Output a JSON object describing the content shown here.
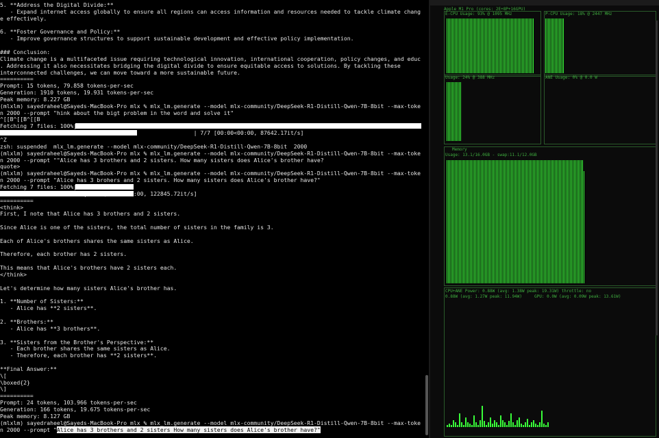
{
  "terminal": {
    "lines": [
      "5. **Address the Digital Divide:**",
      "   - Expand internet access globally to ensure all regions can access information and resources needed to tackle climate chang",
      "e effectively.",
      "",
      "6. **Foster Governance and Policy:**",
      "   - Improve governance structures to support sustainable development and effective policy implementation.",
      "",
      "### Conclusion:",
      "Climate change is a multifaceted issue requiring technological innovation, international cooperation, policy changes, and educ",
      ". Addressing it also necessitates bridging the digital divide to ensure equitable access to solutions. By tackling these",
      "interconnected challenges, we can move toward a more sustainable future.",
      "==========",
      "Prompt: 15 tokens, 79.858 tokens-per-sec",
      "Generation: 1910 tokens, 19.931 tokens-per-sec",
      "Peak memory: 8.227 GB",
      "(mlxlm) sayedraheel@Sayeds-MacBook-Pro mlx % mlx_lm.generate --model mlx-community/DeepSeek-R1-Distill-Qwen-7B-8bit --max-toke",
      "n 2000 --prompt \"hink about the bigt problem in the word and solve it\"",
      "^[[B^[[B^[[B",
      "Fetching 7 files: 100%|",
      "                                                          | 7/7 [00:00<00:00, 87642.17it/s]",
      "^Z",
      "zsh: suspended  mlx_lm.generate --model mlx-community/DeepSeek-R1-Distill-Qwen-7B-8bit  2000",
      "(mlxlm) sayedraheel@Sayeds-MacBook-Pro mlx % mlx_lm.generate --model mlx-community/DeepSeek-R1-Distill-Qwen-7B-8bit --max-toke",
      "n 2000 --prompt \"\"Alice has 3 brothers and 2 sisters. How many sisters does Alice's brother have?",
      "quote>",
      "(mlxlm) sayedraheel@Sayeds-MacBook-Pro mlx % mlx_lm.generate --model mlx-community/DeepSeek-R1-Distill-Qwen-7B-8bit --max-toke",
      "n 2000 --prompt \"Alice has 3 brohers and 2 sisters. How many sisters does Alice's brother have?\"",
      "Fetching 7 files: 100%|",
      "                         | 7/7 [00:00<00:00, 122845.72it/s]",
      "==========",
      "<think>",
      "First, I note that Alice has 3 brothers and 2 sisters.",
      "",
      "Since Alice is one of the sisters, the total number of sisters in the family is 3.",
      "",
      "Each of Alice's brothers shares the same sisters as Alice.",
      "",
      "Therefore, each brother has 2 sisters.",
      "",
      "This means that Alice's brothers have 2 sisters each.",
      "</think>",
      "",
      "Let's determine how many sisters Alice's brother has.",
      "",
      "1. **Number of Sisters:**",
      "   - Alice has **2 sisters**.",
      "",
      "2. **Brothers:**",
      "   - Alice has **3 brothers**.",
      "",
      "3. **Sisters from the Brother's Perspective:**",
      "   - Each brother shares the same sisters as Alice.",
      "   - Therefore, each brother has **2 sisters**.",
      "",
      "**Final Answer:**",
      "\\[",
      "\\boxed{2}",
      "\\]",
      "==========",
      "Prompt: 24 tokens, 103.966 tokens-per-sec",
      "Generation: 166 tokens, 19.675 tokens-per-sec",
      "Peak memory: 8.127 GB",
      "(mlxlm) sayedraheel@Sayeds-MacBook-Pro mlx % mlx_lm.generate --model mlx-community/DeepSeek-R1-Distill-Qwen-7B-8bit --max-toke"
    ],
    "last_prefix": "n 2000 --prompt \"",
    "last_selected": "Alice has 3 brothers and 2 sisters How many sisters does Alice's brother have?\""
  },
  "monitor": {
    "header": "Apple M1 Pro (cores: 2E+8P+16GPU)",
    "e_cpu": "E-CPU Usage: 93% @ 1095 MHz",
    "p_cpu": "P-CPU Usage: 18% @ 2447 MHz",
    "gpu": "Usage: 24% @ 388 MHz",
    "ane": "ANE Usage: 0% @ 0.0 W",
    "memory_title": "Memory",
    "memory": "Usage: 13.1/16.0GB - swap:11.1/12.0GB",
    "power1": "CPU+ANE Power: 0.88W (avg: 1.38W peak: 19.31W) throttle: no",
    "power2": "0.88W (avg: 1.27W peak: 11.94W)     GPU: 0.0W (avg: 0.09W peak: 13.61W)"
  }
}
